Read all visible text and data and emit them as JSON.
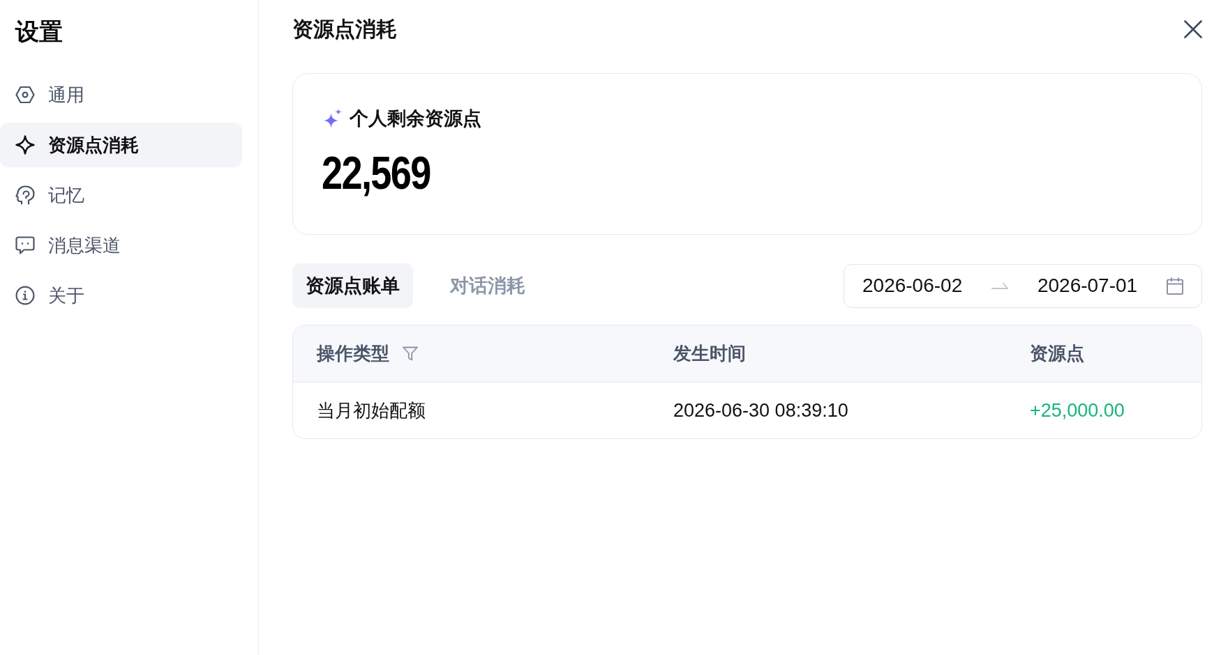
{
  "sidebar": {
    "title": "设置",
    "items": [
      {
        "label": "通用",
        "selected": false
      },
      {
        "label": "资源点消耗",
        "selected": true
      },
      {
        "label": "记忆",
        "selected": false
      },
      {
        "label": "消息渠道",
        "selected": false
      },
      {
        "label": "关于",
        "selected": false
      }
    ]
  },
  "page": {
    "title": "资源点消耗"
  },
  "balance_card": {
    "label": "个人剩余资源点",
    "value": "22,569"
  },
  "tabs": [
    {
      "label": "资源点账单",
      "selected": true
    },
    {
      "label": "对话消耗",
      "selected": false
    }
  ],
  "date_range": {
    "start": "2026-06-02",
    "end": "2026-07-01"
  },
  "table": {
    "columns": [
      {
        "label": "操作类型",
        "filter": true
      },
      {
        "label": "发生时间",
        "filter": false
      },
      {
        "label": "资源点",
        "filter": false
      }
    ],
    "rows": [
      {
        "kind": "credit",
        "cells": [
          "当月初始配额",
          "2026-06-30 08:39:10",
          "+25,000.00"
        ]
      }
    ]
  }
}
